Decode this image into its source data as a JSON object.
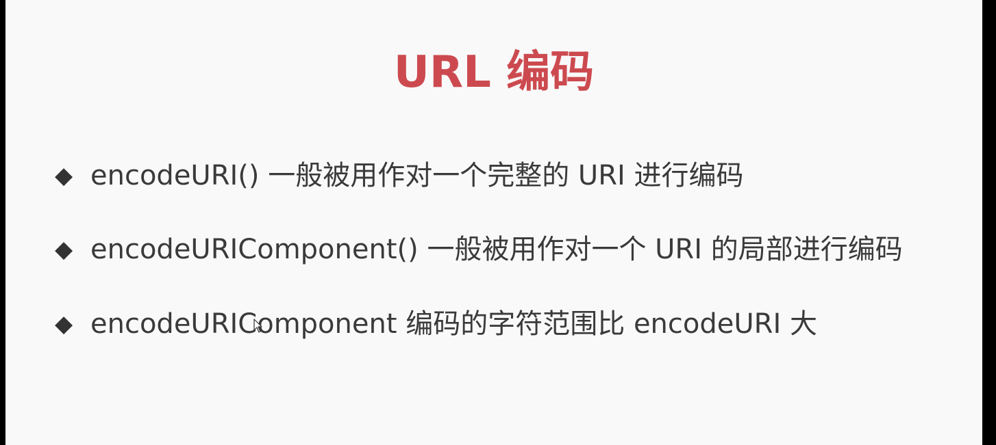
{
  "slide": {
    "title": "URL 编码",
    "bullet_marker": "◆",
    "bullets": [
      {
        "text": "encodeURI() 一般被用作对一个完整的 URI 进行编码"
      },
      {
        "text": "encodeURIComponent() 一般被用作对一个 URI 的局部进行编码"
      },
      {
        "text": "encodeURIComponent 编码的字符范围比 encodeURI 大"
      }
    ]
  },
  "colors": {
    "title": "#cc4a4f",
    "body_text": "#3a3a3a",
    "background": "#f9f9f9"
  },
  "icons": {
    "pointer": "mouse-pointer-icon"
  }
}
